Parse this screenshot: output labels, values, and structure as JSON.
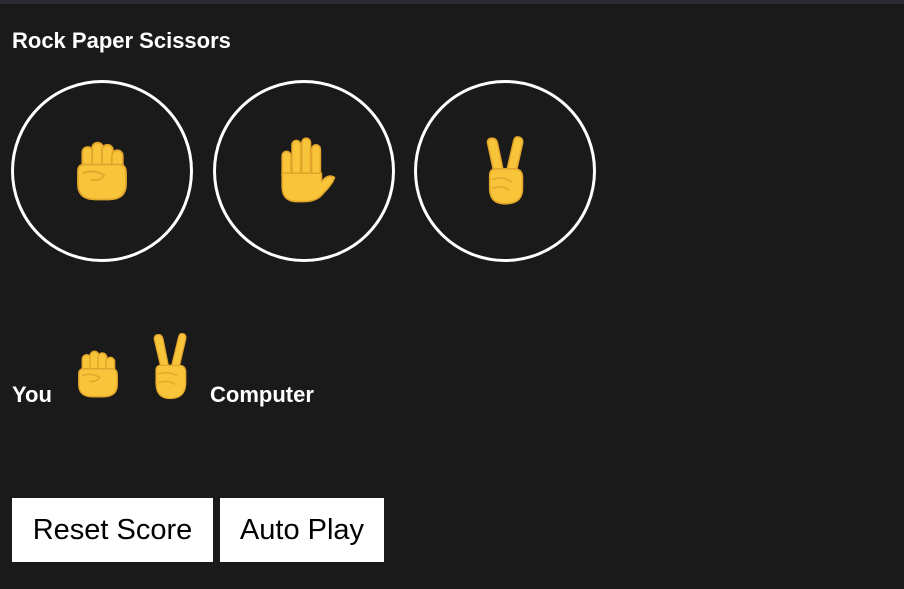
{
  "app": {
    "title": "Rock Paper Scissors"
  },
  "moves": [
    {
      "name": "rock",
      "icon": "rock-fist-icon"
    },
    {
      "name": "paper",
      "icon": "paper-hand-icon"
    },
    {
      "name": "scissors",
      "icon": "scissors-victory-icon"
    }
  ],
  "result": {
    "player_label": "You",
    "player_move": "rock",
    "computer_move": "scissors",
    "computer_label": "Computer"
  },
  "actions": {
    "reset_label": "Reset Score",
    "auto_play_label": "Auto Play"
  },
  "colors": {
    "background": "#1a1a1a",
    "text": "#ffffff",
    "hand": "#f8c43a",
    "hand_line": "#e2a52a",
    "button_bg": "#ffffff",
    "button_text": "#000000"
  }
}
